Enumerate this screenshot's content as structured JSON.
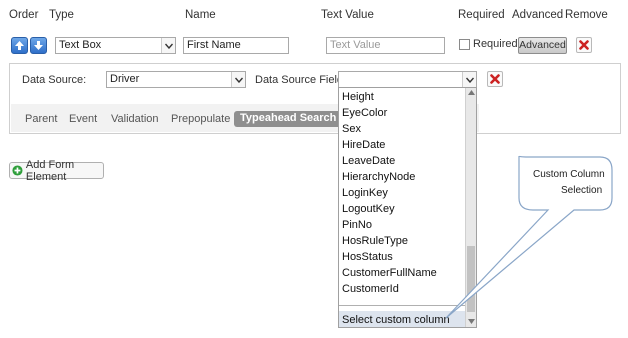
{
  "headers": {
    "order": "Order",
    "type": "Type",
    "name": "Name",
    "text_value": "Text Value",
    "required": "Required",
    "advanced": "Advanced",
    "remove": "Remove"
  },
  "row": {
    "type_value": "Text Box",
    "name_value": "First Name",
    "text_value_placeholder": "Text Value",
    "required_label": "Required",
    "advanced_button": "Advanced"
  },
  "datasource": {
    "label": "Data Source:",
    "value": "Driver",
    "field_label": "Data Source Field:",
    "field_value": ""
  },
  "tabs": [
    "Parent",
    "Event",
    "Validation",
    "Prepopulate",
    "Typeahead Search"
  ],
  "add_button": "Add Form Element",
  "dropdown_items": [
    "Height",
    "EyeColor",
    "Sex",
    "HireDate",
    "LeaveDate",
    "HierarchyNode",
    "LoginKey",
    "LogoutKey",
    "PinNo",
    "HosRuleType",
    "HosStatus",
    "CustomerFullName",
    "CustomerId"
  ],
  "dropdown_footer": "Select custom column",
  "callout": [
    "Custom Column",
    "Selection"
  ],
  "colors": {
    "accent_blue": "#2f6fc9",
    "remove_red": "#cc2222",
    "add_green": "#2e9e3a"
  }
}
